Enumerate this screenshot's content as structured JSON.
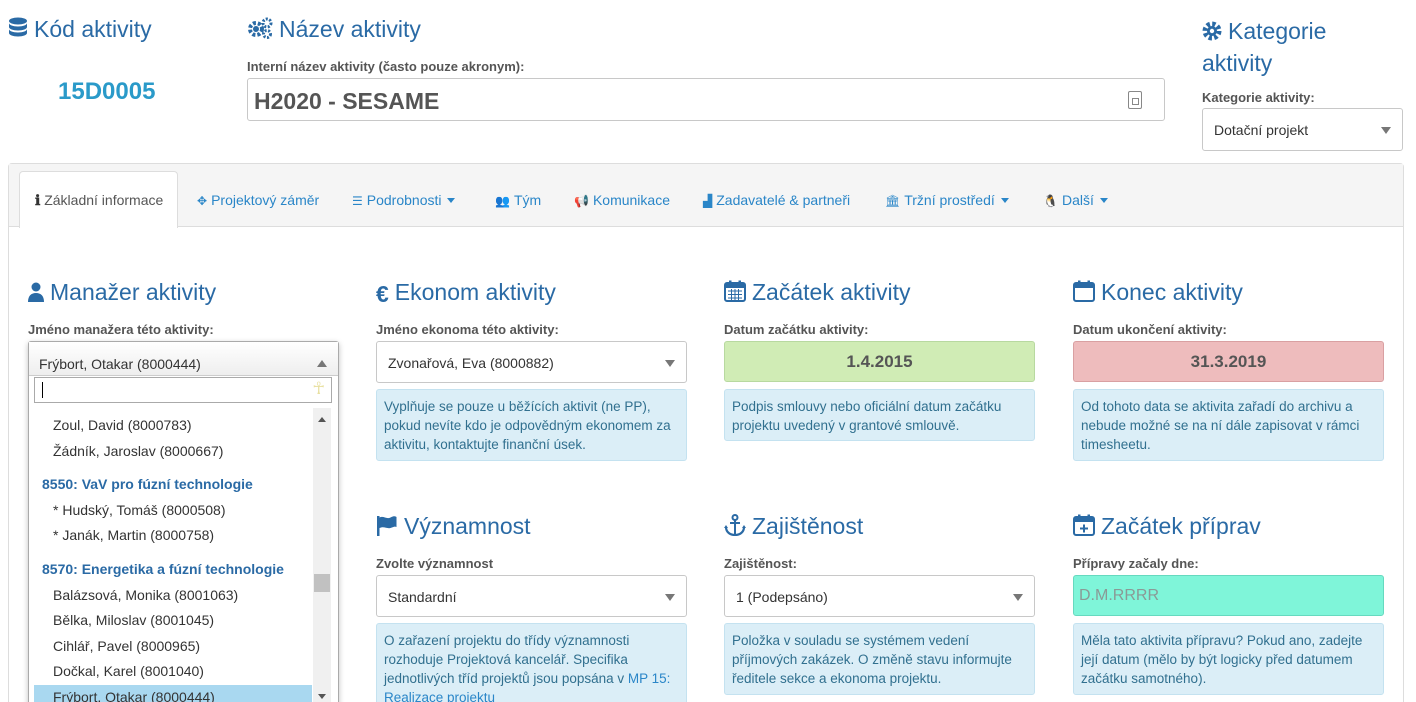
{
  "activity_code": {
    "title": "Kód aktivity",
    "icon": "database-icon",
    "value": "15D0005"
  },
  "activity_name": {
    "title": "Název aktivity",
    "icon": "cogs-icon",
    "label": "Interní název aktivity (často pouze akronym):",
    "value": "H2020 - SESAME"
  },
  "category": {
    "title": "Kategorie aktivity",
    "icon": "gear-icon",
    "label": "Kategorie aktivity:",
    "value": "Dotační projekt"
  },
  "tabs": [
    {
      "label": "Základní informace",
      "icon": "info-icon",
      "active": true
    },
    {
      "label": "Projektový záměr",
      "icon": "crosshair-icon"
    },
    {
      "label": "Podrobnosti",
      "icon": "list-icon",
      "dropdown": true
    },
    {
      "label": "Tým",
      "icon": "users-icon"
    },
    {
      "label": "Komunikace",
      "icon": "bullhorn-icon"
    },
    {
      "label": "Zadavatelé & partneři",
      "icon": "area-chart-icon"
    },
    {
      "label": "Tržní prostředí",
      "icon": "bank-icon",
      "dropdown": true
    },
    {
      "label": "Další",
      "icon": "linux-icon",
      "dropdown": true
    }
  ],
  "manager": {
    "title": "Manažer aktivity",
    "label": "Jméno manažera této aktivity:",
    "value": "Frýbort, Otakar (8000444)",
    "options": [
      {
        "type": "opt",
        "text": "Zoul, David (8000783)"
      },
      {
        "type": "opt",
        "text": "Žádník, Jaroslav (8000667)"
      },
      {
        "type": "grp",
        "text": "8550: VaV pro fúzní technologie"
      },
      {
        "type": "opt",
        "text": "* Hudský, Tomáš (8000508)"
      },
      {
        "type": "opt",
        "text": "* Janák, Martin (8000758)"
      },
      {
        "type": "grp",
        "text": "8570: Energetika a fúzní technologie"
      },
      {
        "type": "opt",
        "text": "Balázsová, Monika (8001063)"
      },
      {
        "type": "opt",
        "text": "Bělka, Miloslav (8001045)"
      },
      {
        "type": "opt",
        "text": "Cihlář, Pavel (8000965)"
      },
      {
        "type": "opt",
        "text": "Dočkal, Karel (8001040)"
      },
      {
        "type": "opt",
        "text": "Frýbort, Otakar (8000444)",
        "selected": true
      }
    ]
  },
  "economist": {
    "title": "Ekonom aktivity",
    "label": "Jméno ekonoma této aktivity:",
    "value": "Zvonařová, Eva (8000882)",
    "help": "Vyplňuje se pouze u běžících aktivit (ne PP), pokud nevíte kdo je odpovědným ekonomem za aktivitu, kontaktujte finanční úsek."
  },
  "start": {
    "title": "Začátek aktivity",
    "label": "Datum začátku aktivity:",
    "value": "1.4.2015",
    "help": "Podpis smlouvy nebo oficiální datum začátku projektu uvedený v grantové smlouvě.",
    "color": "#d0ecb5"
  },
  "end": {
    "title": "Konec aktivity",
    "label": "Datum ukončení aktivity:",
    "value": "31.3.2019",
    "help": "Od tohoto data se aktivita zařadí do archivu a nebude možné se na ní dále zapisovat v rámci timesheetu.",
    "color": "#eebcbd"
  },
  "significance": {
    "title": "Významnost",
    "label": "Zvolte významnost",
    "value": "Standardní",
    "help_text": "O zařazení projektu do třídy významnosti rozhoduje Projektová kancelář. Specifika jednotlivých tříd projektů jsou popsána v ",
    "help_link": "MP 15: Realizace projektu"
  },
  "assurance": {
    "title": "Zajištěnost",
    "label": "Zajištěnost:",
    "value": "1 (Podepsáno)",
    "help": "Položka v souladu se systémem vedení příjmových zakázek. O změně stavu informujte ředitele sekce a ekonoma projektu."
  },
  "prep_start": {
    "title": "Začátek příprav",
    "label": "Přípravy začaly dne:",
    "placeholder": "D.M.RRRR",
    "help": "Měla tato aktivita přípravu? Pokud ano, zadejte její datum (mělo by být logicky před datumem začátku samotného).",
    "color": "#7ff5d9"
  }
}
